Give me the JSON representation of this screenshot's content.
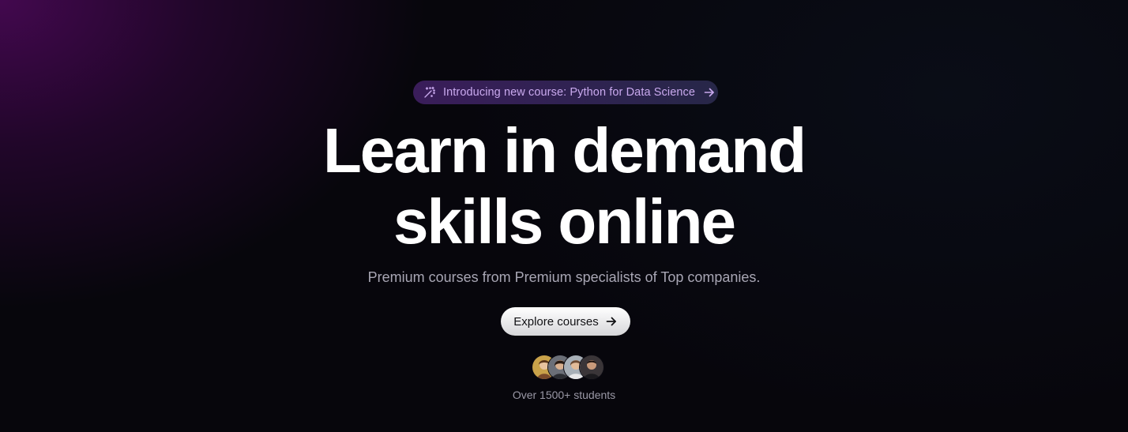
{
  "announcement": {
    "text": "Introducing new course: Python for Data Science",
    "icon": "sparkles-icon",
    "arrow_icon": "arrow-right-icon"
  },
  "hero": {
    "headline_line1": "Learn in demand",
    "headline_line2": "skills online",
    "subtitle": "Premium courses from Premium specialists of Top companies."
  },
  "cta": {
    "label": "Explore courses",
    "icon": "arrow-right-icon"
  },
  "social_proof": {
    "avatar_count": 4,
    "text": "Over 1500+ students"
  },
  "colors": {
    "background": "#07060c",
    "glow": "#460852",
    "badge_text": "#c9a9ee",
    "subtitle": "#a8a6b4"
  }
}
